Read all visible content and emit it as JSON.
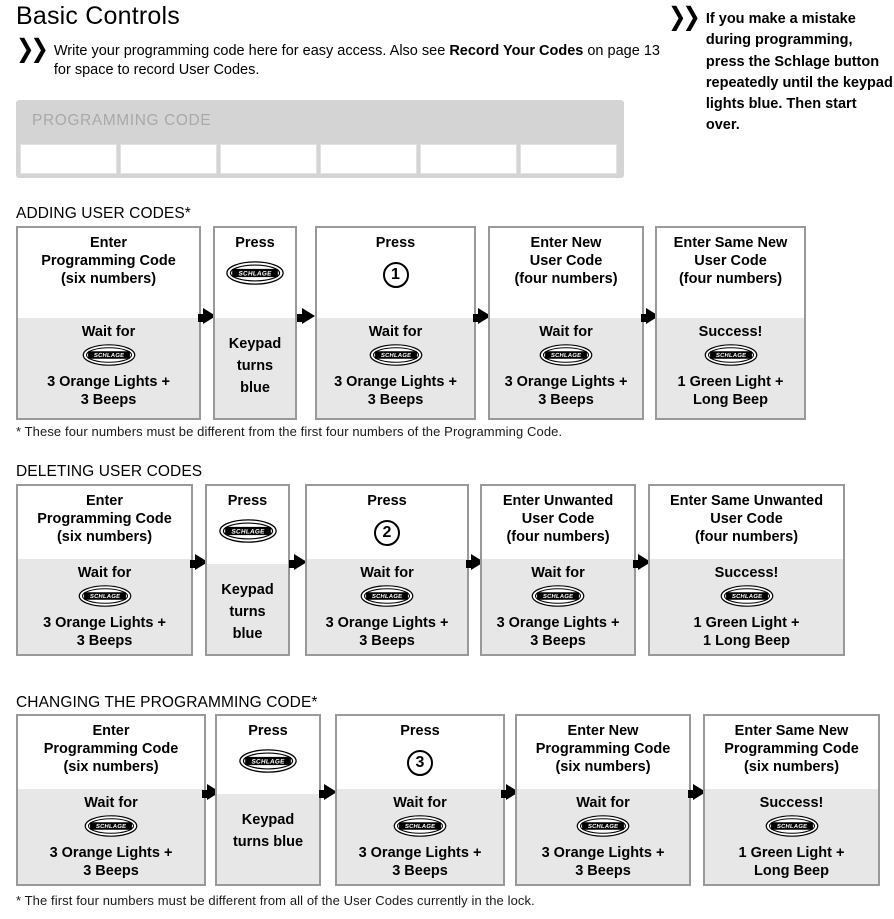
{
  "header": {
    "title": "Basic Controls",
    "chevron_icon": "double-chevron-right-icon",
    "intro_part1": "Write your programming code here for easy access. Also see ",
    "intro_bold1": "Record Your Codes",
    "intro_part2": " on page 13 for space to record User Codes.",
    "note": "If you make a mistake during programming, press the Schlage button repeatedly until the keypad lights blue. Then start over."
  },
  "programming_code": {
    "label": "PROGRAMMING CODE",
    "cells": [
      "",
      "",
      "",
      "",
      "",
      ""
    ],
    "panel_color": "#d4d4d4",
    "label_color": "#a9a9a9"
  },
  "sections": [
    {
      "title": "ADDING USER CODES*",
      "footnote": "* These four numbers must be different from the first four numbers of the Programming Code.",
      "steps": [
        {
          "top_lines": [
            "Enter",
            "Programming Code",
            "(six numbers)"
          ],
          "bot_lines": [
            "Wait for"
          ],
          "bot_logo": "schlage-logo-icon",
          "bot_after": [
            "3 Orange Lights +",
            "3 Beeps"
          ]
        },
        {
          "top_lines": [
            "Press"
          ],
          "top_logo": "schlage-logo-icon",
          "bot_lines": [
            "Keypad",
            "turns",
            "blue"
          ]
        },
        {
          "top_lines": [
            "Press"
          ],
          "top_number": "1",
          "bot_lines": [
            "Wait for"
          ],
          "bot_logo": "schlage-logo-icon",
          "bot_after": [
            "3 Orange Lights +",
            "3 Beeps"
          ]
        },
        {
          "top_lines": [
            "Enter New",
            "User Code",
            "(four numbers)"
          ],
          "bot_lines": [
            "Wait for"
          ],
          "bot_logo": "schlage-logo-icon",
          "bot_after": [
            "3 Orange Lights +",
            "3 Beeps"
          ]
        },
        {
          "top_lines": [
            "Enter Same New",
            "User Code",
            "(four numbers)"
          ],
          "bot_lines": [
            "Success!"
          ],
          "bot_logo": "schlage-logo-icon",
          "bot_after": [
            "1 Green Light +",
            "Long Beep"
          ]
        }
      ]
    },
    {
      "title": "DELETING USER CODES",
      "footnote": "",
      "steps": [
        {
          "top_lines": [
            "Enter",
            "Programming Code",
            "(six numbers)"
          ],
          "bot_lines": [
            "Wait for"
          ],
          "bot_logo": "schlage-logo-icon",
          "bot_after": [
            "3 Orange Lights +",
            "3 Beeps"
          ]
        },
        {
          "top_lines": [
            "Press"
          ],
          "top_logo": "schlage-logo-icon",
          "bot_lines": [
            "Keypad",
            "turns",
            "blue"
          ]
        },
        {
          "top_lines": [
            "Press"
          ],
          "top_number": "2",
          "bot_lines": [
            "Wait for"
          ],
          "bot_logo": "schlage-logo-icon",
          "bot_after": [
            "3 Orange Lights +",
            "3 Beeps"
          ]
        },
        {
          "top_lines": [
            "Enter Unwanted",
            "User Code",
            "(four numbers)"
          ],
          "bot_lines": [
            "Wait for"
          ],
          "bot_logo": "schlage-logo-icon",
          "bot_after": [
            "3 Orange Lights +",
            "3 Beeps"
          ]
        },
        {
          "top_lines": [
            "Enter Same Unwanted",
            "User Code",
            "(four numbers)"
          ],
          "bot_lines": [
            "Success!"
          ],
          "bot_logo": "schlage-logo-icon",
          "bot_after": [
            "1 Green Light +",
            "1 Long Beep"
          ]
        }
      ]
    },
    {
      "title": "CHANGING THE PROGRAMMING CODE*",
      "footnote": "* The first four numbers must be different from all of the User Codes currently in the lock.",
      "steps": [
        {
          "top_lines": [
            "Enter",
            "Programming Code",
            "(six numbers)"
          ],
          "bot_lines": [
            "Wait for"
          ],
          "bot_logo": "schlage-logo-icon",
          "bot_after": [
            "3 Orange Lights +",
            "3 Beeps"
          ]
        },
        {
          "top_lines": [
            "Press"
          ],
          "top_logo": "schlage-logo-icon",
          "bot_lines": [
            "Keypad",
            "turns blue"
          ]
        },
        {
          "top_lines": [
            "Press"
          ],
          "top_number": "3",
          "bot_lines": [
            "Wait for"
          ],
          "bot_logo": "schlage-logo-icon",
          "bot_after": [
            "3 Orange Lights +",
            "3 Beeps"
          ]
        },
        {
          "top_lines": [
            "Enter New",
            "Programming Code",
            "(six numbers)"
          ],
          "bot_lines": [
            "Wait for"
          ],
          "bot_logo": "schlage-logo-icon",
          "bot_after": [
            "3 Orange Lights +",
            "3 Beeps"
          ]
        },
        {
          "top_lines": [
            "Enter Same New",
            "Programming Code",
            "(six numbers)"
          ],
          "bot_lines": [
            "Success!"
          ],
          "bot_logo": "schlage-logo-icon",
          "bot_after": [
            "1 Green Light +",
            "Long Beep"
          ]
        }
      ]
    }
  ],
  "colors": {
    "box_border": "#999999",
    "box_bottom_fill": "#e7e7e7",
    "text": "#000000"
  }
}
